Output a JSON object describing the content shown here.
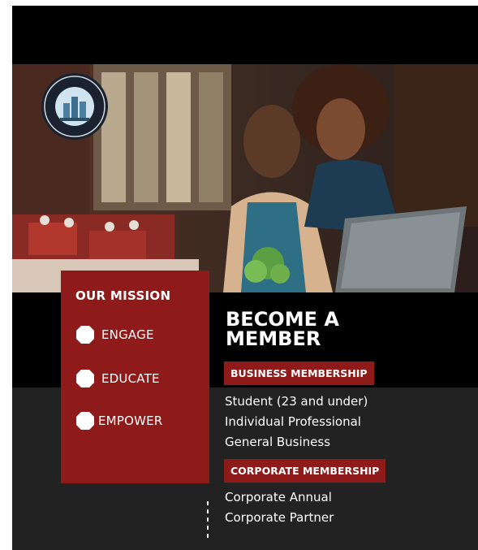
{
  "mission": {
    "title": "OUR MISSION",
    "items": [
      "ENGAGE",
      "EDUCATE",
      "EMPOWER"
    ]
  },
  "headline": {
    "line1": "BECOME A",
    "line2": "MEMBER"
  },
  "business": {
    "label": "BUSINESS MEMBERSHIP",
    "tiers": [
      "Student (23 and under)",
      "Individual Professional",
      "General Business"
    ]
  },
  "corporate": {
    "label": "CORPORATE MEMBERSHIP",
    "tiers": [
      "Corporate Annual",
      "Corporate Partner"
    ]
  },
  "colors": {
    "brand_red": "#8e1a1a",
    "background_black": "#000000",
    "background_gray": "#222222",
    "text_white": "#ffffff"
  },
  "icons": {
    "bullet": "white-octagon-bullet-icon",
    "seal": "chamber-seal-logo"
  }
}
